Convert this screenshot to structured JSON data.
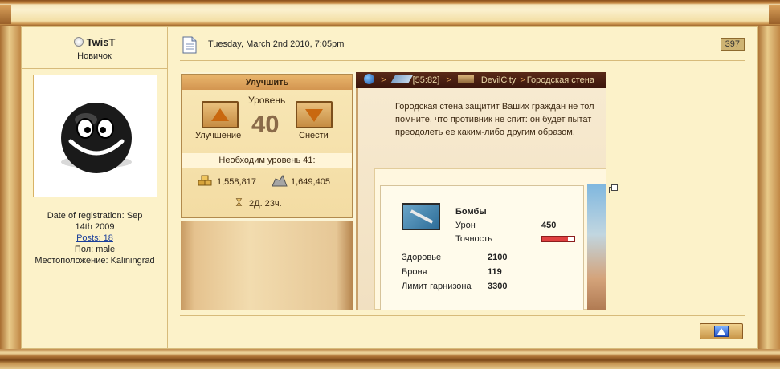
{
  "user": {
    "name": "TwisT",
    "rank": "Новичок",
    "registration": "Date of registration: Sep 14th 2009",
    "posts": "Posts: 18",
    "gender": "Пол: male",
    "location": "Местоположение: Kaliningrad"
  },
  "post": {
    "date": "Tuesday, March 2nd 2010, 7:05pm",
    "number": "397"
  },
  "game": {
    "panel_title": "Улучшить",
    "level_label": "Уровень",
    "level": "40",
    "upgrade_label": "Улучшение",
    "demolish_label": "Снести",
    "required_level": "Необходим уровень 41:",
    "resource_gold": "1,558,817",
    "resource_stone": "1,649,405",
    "time": "2Д. 23ч.",
    "breadcrumb_coords": "[55:82]",
    "breadcrumb_city": "DevilCity",
    "breadcrumb_building": "Городская стена",
    "description_line1": "Городская стена защитит Ваших граждан не тол",
    "description_line2": "помните, что противник не спит: он будет пытат",
    "description_line3": "преодолеть ее каким-либо другим образом.",
    "weapon_name": "Бомбы",
    "damage_label": "Урон",
    "damage_value": "450",
    "accuracy_label": "Точность",
    "accuracy_fraction": 0.8,
    "health_label": "Здоровье",
    "health_value": "2100",
    "armor_label": "Броня",
    "armor_value": "119",
    "garrison_label": "Лимит гарнизона",
    "garrison_value": "3300"
  },
  "colors": {
    "frame": "#b8833f",
    "post_bg": "#fcf2c9",
    "border": "#d7bb7a",
    "link": "#1a3e9a"
  }
}
